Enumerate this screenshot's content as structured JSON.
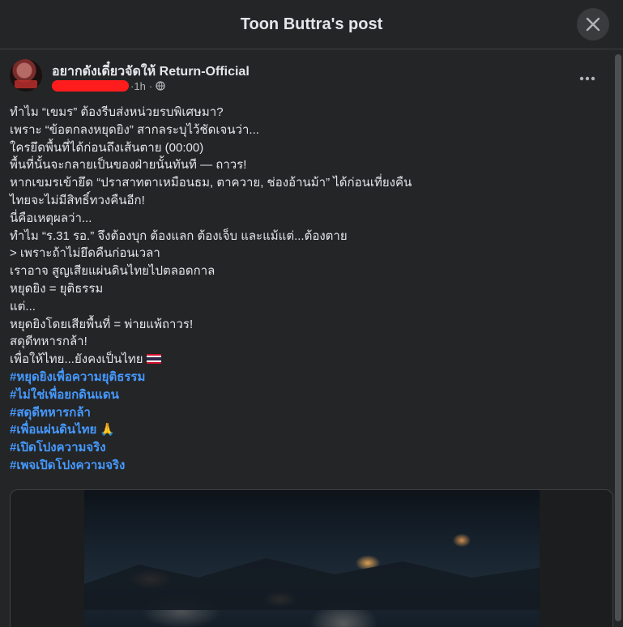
{
  "dialog": {
    "title": "Toon Buttra's post"
  },
  "post": {
    "author": "อยากดังเดี๋ยวจัดให้ Return-Official",
    "time": "1h",
    "separator": "·",
    "privacy_icon": "globe-icon",
    "more_icon": "more-options-icon",
    "lines": [
      "ทำไม “เขมร” ต้องรีบส่งหน่วยรบพิเศษมา?",
      "เพราะ “ข้อตกลงหยุดยิง” สากลระบุไว้ชัดเจนว่า...",
      "ใครยึดพื้นที่ได้ก่อนถึงเส้นตาย (00:00)",
      "พื้นที่นั้นจะกลายเป็นของฝ่ายนั้นทันที — ถาวร!",
      "หากเขมรเข้ายึด “ปราสาทตาเหมือนธม, ตาควาย, ช่องอ้านม้า” ได้ก่อนเที่ยงคืน",
      "ไทยจะไม่มีสิทธิ์ทวงคืนอีก!",
      "นี่คือเหตุผลว่า...",
      "ทำไม “ร.31 รอ.” จึงต้องบุก ต้องแลก ต้องเจ็บ และแม้แต่...ต้องตาย",
      "> เพราะถ้าไม่ยึดคืนก่อนเวลา",
      "เราอาจ สูญเสียแผ่นดินไทยไปตลอดกาล",
      "หยุดยิง = ยุติธรรม",
      "แต่...",
      "หยุดยิงโดยเสียพื้นที่ = พ่ายแพ้ถาวร!",
      "สดุดีทหารกล้า!",
      "เพื่อให้ไทย...ยังคงเป็นไทย"
    ],
    "flag_emoji": "🇹🇭",
    "hashtags": [
      "#หยุดยิงเพื่อความยุติธรรม",
      "#ไม่ใช่เพื่อยกดินแดน",
      "#สดุดีทหารกล้า",
      "#เพื่อแผ่นดินไทย",
      "#เปิดโปงความจริง",
      "#เพจเปิดโปงความจริง"
    ],
    "pray_emoji": "🙏"
  },
  "colors": {
    "background": "#242526",
    "text": "#e4e6eb",
    "secondary_text": "#b0b3b8",
    "hashtag": "#4599ff",
    "redaction": "#ff1c1c"
  }
}
